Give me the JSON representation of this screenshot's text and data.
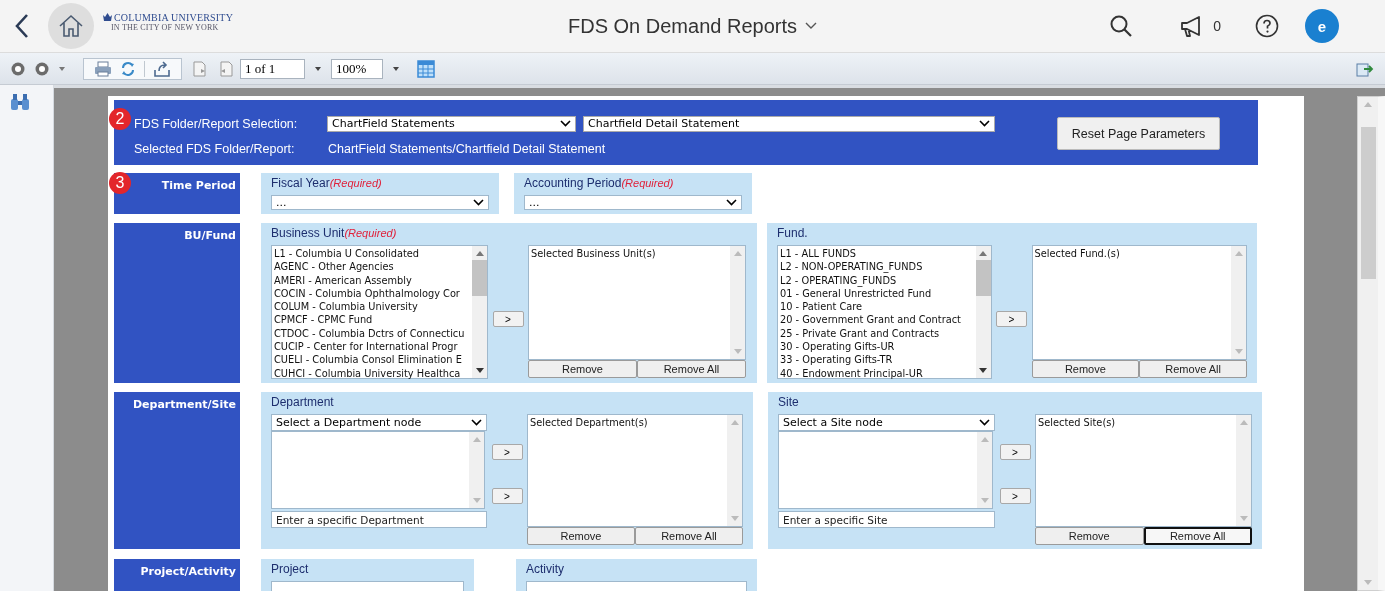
{
  "header": {
    "logo_line1": "COLUMBIA UNIVERSITY",
    "logo_line2": "IN THE CITY OF NEW YORK",
    "title": "FDS On Demand Reports",
    "notifications": "0",
    "avatar": "e"
  },
  "toolbar": {
    "page": "1 of 1",
    "zoom": "100%"
  },
  "report": {
    "step_badges": [
      "2",
      "3"
    ],
    "selection_label": "FDS Folder/Report Selection:",
    "folder_select": "ChartField Statements",
    "report_select": "Chartfield Detail Statement",
    "selected_label": "Selected FDS Folder/Report:",
    "selected_value": "ChartField Statements/Chartfield Detail Statement",
    "reset_button": "Reset Page Parameters"
  },
  "sections": [
    {
      "title": "Time Period",
      "groups": [
        {
          "kind": "dropdown",
          "label": "Fiscal Year",
          "required_note": "(Required)",
          "value": "..."
        },
        {
          "kind": "dropdown",
          "label": "Accounting Period",
          "required_note": "(Required)",
          "value": "..."
        }
      ]
    },
    {
      "title": "BU/Fund",
      "groups": [
        {
          "kind": "picklist",
          "label": "Business Unit",
          "required_note": "(Required)",
          "options": [
            "L1 - Columbia U Consolidated",
            "AGENC - Other Agencies",
            "AMERI - American Assembly",
            "COCIN - Columbia Ophthalmology Cor",
            "COLUM - Columbia University",
            "CPMCF - CPMC Fund",
            "CTDOC - Columbia Dctrs of Connecticu",
            "CUCIP - Center for International Progr",
            "CUELI - Columbia Consol Elimination E",
            "CUHCI - Columbia University Healthca"
          ],
          "add_button": ">",
          "selected_title": "Selected Business Unit(s)",
          "remove_button": "Remove",
          "remove_all_button": "Remove All",
          "remove_all_focused": false
        },
        {
          "kind": "picklist",
          "label": "Fund.",
          "options": [
            "L1 - ALL FUNDS",
            "L2 - NON-OPERATING_FUNDS",
            "L2 - OPERATING_FUNDS",
            "01 - General Unrestricted Fund",
            "10 - Patient Care",
            "20 - Government Grant and Contract",
            "25 - Private Grant and Contracts",
            "30 - Operating Gifts-UR",
            "33 - Operating Gifts-TR",
            "40 - Endowment Principal-UR"
          ],
          "add_button": ">",
          "selected_title": "Selected Fund.(s)",
          "remove_button": "Remove",
          "remove_all_button": "Remove All",
          "remove_all_focused": false
        }
      ]
    },
    {
      "title": "Department/Site",
      "groups": [
        {
          "kind": "tree",
          "label": "Department",
          "node_select": "Select a Department node",
          "search_placeholder": "Enter a specific Department",
          "add_buttons": [
            ">",
            ">"
          ],
          "selected_title": "Selected Department(s)",
          "remove_button": "Remove",
          "remove_all_button": "Remove All",
          "remove_all_focused": false
        },
        {
          "kind": "tree",
          "label": "Site",
          "node_select": "Select a Site node",
          "search_placeholder": "Enter a specific Site",
          "add_buttons": [
            ">",
            ">"
          ],
          "selected_title": "Selected Site(s)",
          "remove_button": "Remove",
          "remove_all_button": "Remove All",
          "remove_all_focused": true
        }
      ]
    },
    {
      "title": "Project/Activity",
      "groups": [
        {
          "kind": "partial",
          "label": "Project"
        },
        {
          "kind": "partial",
          "label": "Activity"
        }
      ]
    }
  ]
}
